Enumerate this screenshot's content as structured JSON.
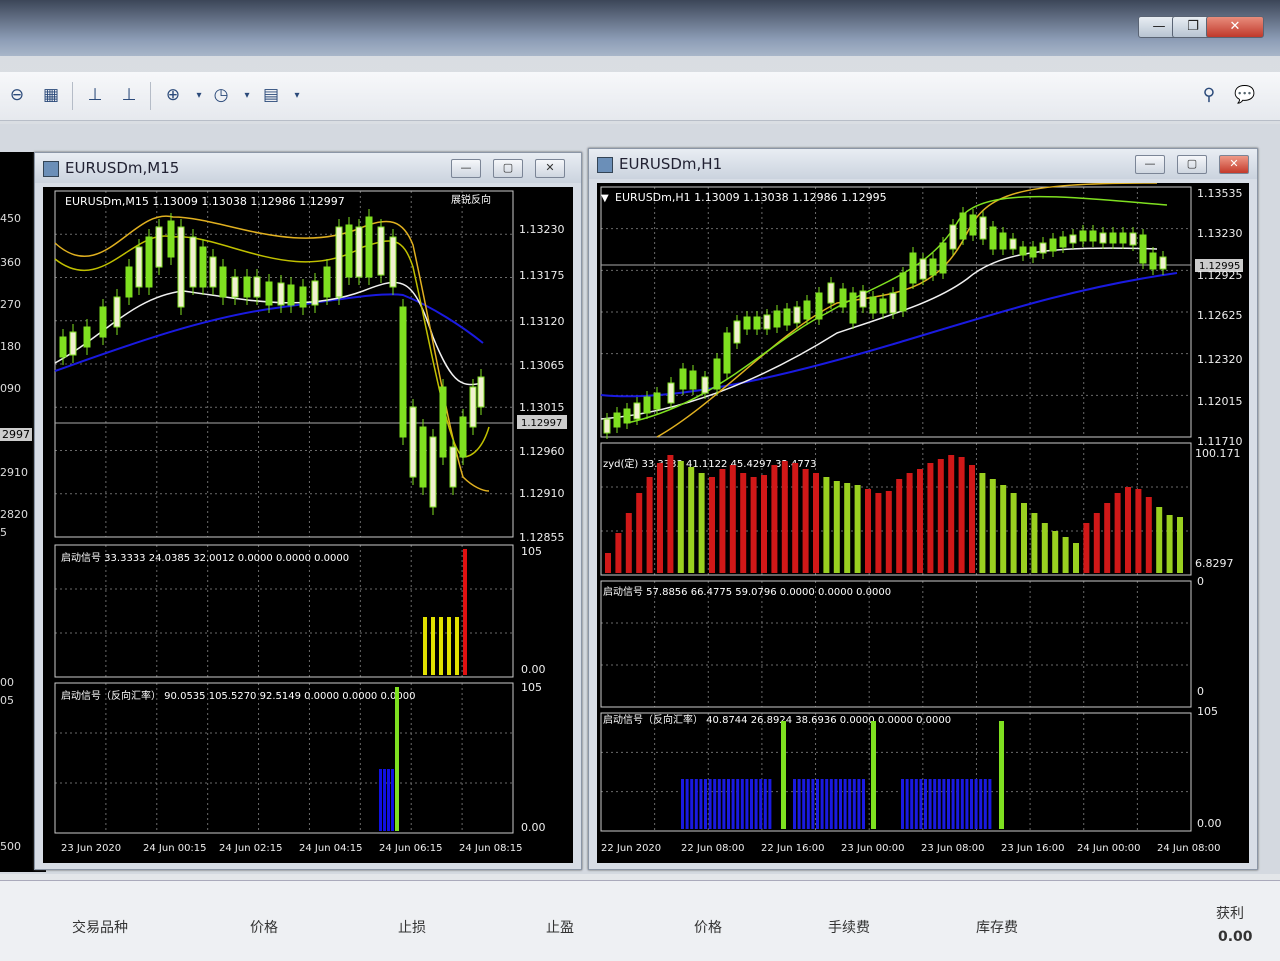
{
  "toolbar": {
    "icons": [
      "zoom-out-icon",
      "tile-windows-icon",
      "chart-shift-icon",
      "autoscroll-icon",
      "indicators-icon",
      "periods-icon",
      "templates-icon",
      "search-icon",
      "chat-icon"
    ]
  },
  "window_controls": {
    "minimize": "—",
    "maximize": "❐",
    "close": "✕"
  },
  "left_strip": {
    "prices": [
      "450",
      "360",
      "270",
      "180",
      "090",
      "2997",
      "2910",
      "2820",
      "5",
      "00",
      "05",
      "500"
    ]
  },
  "chart_m15": {
    "title": "EURUSDm,M15",
    "header": "EURUSDm,M15  1.13009 1.13038 1.12986 1.12997",
    "corner_label": "展锐反向",
    "price_labels": [
      "1.13230",
      "1.13175",
      "1.13120",
      "1.13065",
      "1.13015",
      "1.12997",
      "1.12960",
      "1.12910",
      "1.12855"
    ],
    "sub1": {
      "label": "启动信号 33.3333 24.0385 32.0012 0.0000 0.0000 0.0000",
      "scale_top": "105",
      "scale_bottom": "0.00"
    },
    "sub2": {
      "label": "启动信号（反向汇率） 90.0535 105.5270 92.5149 0.0000 0.0000 0.0000",
      "scale_top": "105",
      "scale_bottom": "0.00"
    },
    "time_labels": [
      "23 Jun 2020",
      "24 Jun 00:15",
      "24 Jun 02:15",
      "24 Jun 04:15",
      "24 Jun 06:15",
      "24 Jun 08:15"
    ]
  },
  "chart_h1": {
    "title": "EURUSDm,H1",
    "header": "EURUSDm,H1  1.13009 1.13038 1.12986 1.12995",
    "price_labels": [
      "1.13535",
      "1.13230",
      "1.12995",
      "1.12925",
      "1.12625",
      "1.12320",
      "1.12015",
      "1.11710"
    ],
    "sub1": {
      "label": "zyd(定) 33.3333 41.1122 45.4297 32.4773",
      "scale_top": "100.171",
      "scale_bottom": "6.8297"
    },
    "sub2": {
      "label": "启动信号 57.8856 66.4775 59.0796 0.0000 0.0000 0.0000",
      "scale_top": "0",
      "scale_bottom": "0"
    },
    "sub3": {
      "label": "启动信号（反向汇率） 40.8744 26.8924 38.6936 0.0000 0.0000 0.0000",
      "scale_top": "105",
      "scale_bottom": "0.00"
    },
    "time_labels": [
      "22 Jun 2020",
      "22 Jun 08:00",
      "22 Jun 16:00",
      "23 Jun 00:00",
      "23 Jun 08:00",
      "23 Jun 16:00",
      "24 Jun 00:00",
      "24 Jun 08:00"
    ]
  },
  "terminal": {
    "columns": [
      "交易品种",
      "价格",
      "止损",
      "止盈",
      "价格",
      "手续费",
      "库存费",
      "获利"
    ],
    "profit_value": "0.00"
  }
}
